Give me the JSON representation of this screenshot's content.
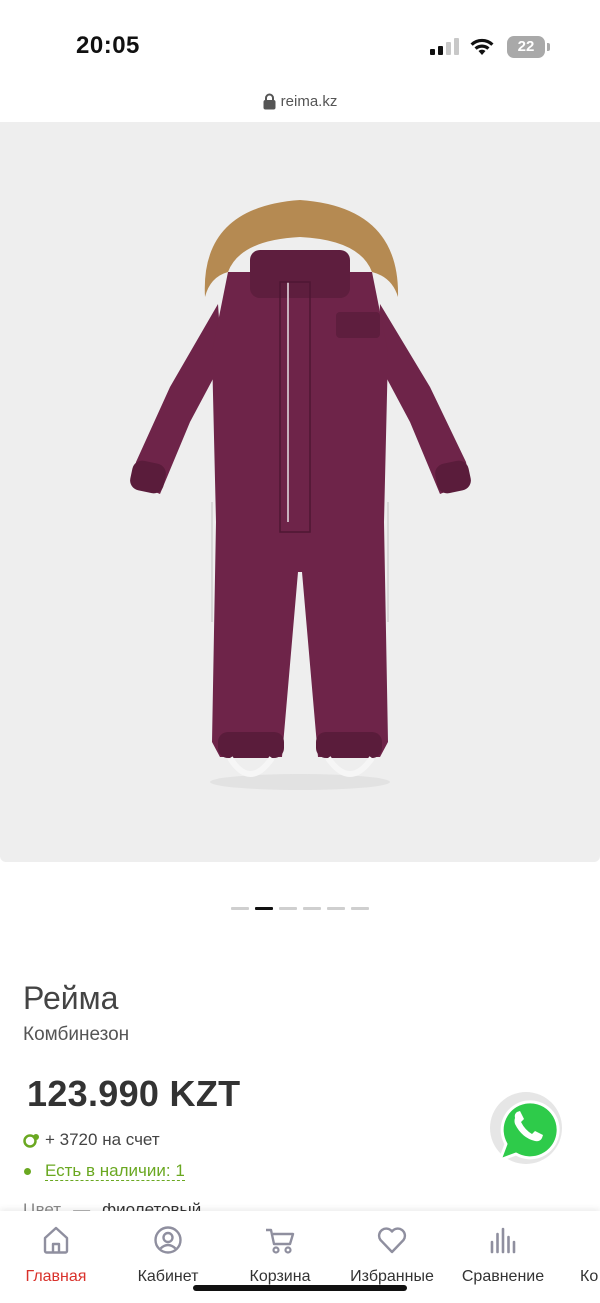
{
  "status_bar": {
    "time": "20:05",
    "battery": "22"
  },
  "browser": {
    "url": "reima.kz"
  },
  "gallery": {
    "pages": 6,
    "active_index": 1
  },
  "product": {
    "brand": "Рейма",
    "type": "Комбинезон",
    "price": "123.990 KZT",
    "bonus": "+ 3720 на счет",
    "stock": "Есть в наличии: 1",
    "color_label": "Цвет",
    "color_dash": "—",
    "color_value": "фиолетовый",
    "garment_color": "#6e2449",
    "fur_color": "#b58a52"
  },
  "nav": {
    "home": "Главная",
    "cabinet": "Кабинет",
    "cart": "Корзина",
    "favorites": "Избранные",
    "compare": "Сравнение",
    "more": "Ко"
  },
  "colors": {
    "accent": "#d9312b",
    "stock": "#6aa821",
    "whatsapp": "#2ecb4a"
  }
}
